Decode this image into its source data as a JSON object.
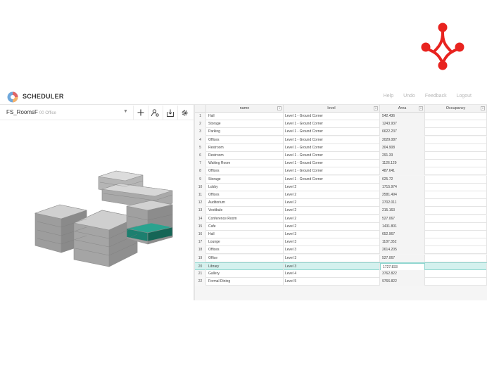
{
  "app": {
    "title": "SCHEDULER",
    "nav": [
      "Help",
      "Undo",
      "Feedback",
      "Logout"
    ]
  },
  "toolbar": {
    "file_name": "FS_RoomsF",
    "file_sub": "00 Office",
    "icons": [
      "plus-icon",
      "user-settings-icon",
      "download-icon",
      "gear-icon"
    ]
  },
  "colors": {
    "brand": "#e8231f",
    "selected_row": "#d4f1ee",
    "highlight_block": "#1d7f6f"
  },
  "grid": {
    "columns": [
      "name",
      "level",
      "Area",
      "Occupancy"
    ],
    "selected_row": 20,
    "rows": [
      {
        "num": "1",
        "name": "Hall",
        "level": "Level 1 - Ground Corner",
        "area": "542.436",
        "occ": ""
      },
      {
        "num": "2",
        "name": "Storage",
        "level": "Level 1 - Ground Corner",
        "area": "1243.937",
        "occ": ""
      },
      {
        "num": "3",
        "name": "Parking",
        "level": "Level 1 - Ground Corner",
        "area": "6622.237",
        "occ": ""
      },
      {
        "num": "4",
        "name": "Offices",
        "level": "Level 1 - Ground Corner",
        "area": "2029.087",
        "occ": ""
      },
      {
        "num": "5",
        "name": "Restroom",
        "level": "Level 1 - Ground Corner",
        "area": "304.908",
        "occ": ""
      },
      {
        "num": "6",
        "name": "Restroom",
        "level": "Level 1 - Ground Corner",
        "area": "291.33",
        "occ": ""
      },
      {
        "num": "7",
        "name": "Waiting Room",
        "level": "Level 1 - Ground Corner",
        "area": "1126.129",
        "occ": ""
      },
      {
        "num": "8",
        "name": "Offices",
        "level": "Level 1 - Ground Corner",
        "area": "487.641",
        "occ": ""
      },
      {
        "num": "9",
        "name": "Storage",
        "level": "Level 1 - Ground Corner",
        "area": "625.72",
        "occ": ""
      },
      {
        "num": "10",
        "name": "Lobby",
        "level": "Level 2",
        "area": "1715.974",
        "occ": ""
      },
      {
        "num": "11",
        "name": "Offices",
        "level": "Level 2",
        "area": "2581.494",
        "occ": ""
      },
      {
        "num": "12",
        "name": "Auditorium",
        "level": "Level 2",
        "area": "2702.011",
        "occ": ""
      },
      {
        "num": "13",
        "name": "Vestibule",
        "level": "Level 2",
        "area": "215.163",
        "occ": ""
      },
      {
        "num": "14",
        "name": "Conference Room",
        "level": "Level 2",
        "area": "527.067",
        "occ": ""
      },
      {
        "num": "15",
        "name": "Cafe",
        "level": "Level 2",
        "area": "1431.801",
        "occ": ""
      },
      {
        "num": "16",
        "name": "Hall",
        "level": "Level 3",
        "area": "652.967",
        "occ": ""
      },
      {
        "num": "17",
        "name": "Lounge",
        "level": "Level 3",
        "area": "1187.352",
        "occ": ""
      },
      {
        "num": "18",
        "name": "Offices",
        "level": "Level 3",
        "area": "2614.205",
        "occ": ""
      },
      {
        "num": "19",
        "name": "Office",
        "level": "Level 3",
        "area": "527.067",
        "occ": ""
      },
      {
        "num": "20",
        "name": "Library",
        "level": "Level 3",
        "area": "1727.833",
        "occ": ""
      },
      {
        "num": "21",
        "name": "Gallery",
        "level": "Level 4",
        "area": "3762.822",
        "occ": ""
      },
      {
        "num": "22",
        "name": "Formal Dining",
        "level": "Level 5",
        "area": "9766.822",
        "occ": ""
      }
    ]
  }
}
